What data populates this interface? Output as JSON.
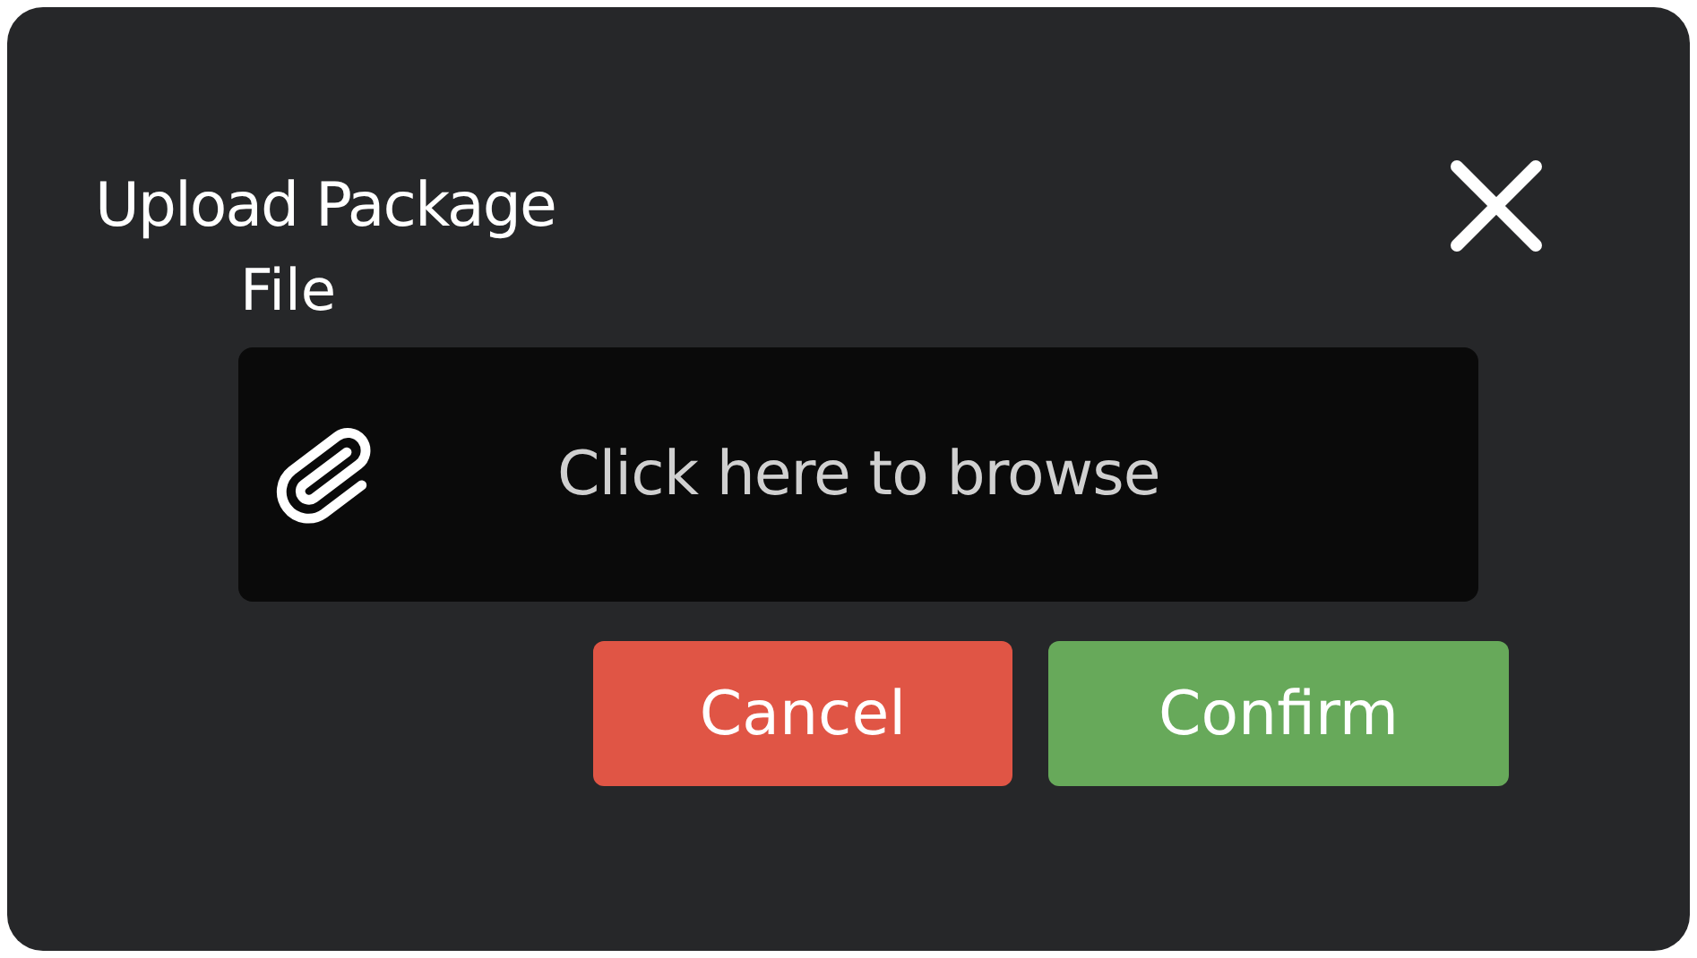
{
  "dialog": {
    "title": "Upload Package"
  },
  "file_field": {
    "label": "File",
    "placeholder": "Click here to browse"
  },
  "buttons": [
    {
      "label": "Cancel",
      "kind": "cancel"
    },
    {
      "label": "Confirm",
      "kind": "confirm"
    }
  ]
}
